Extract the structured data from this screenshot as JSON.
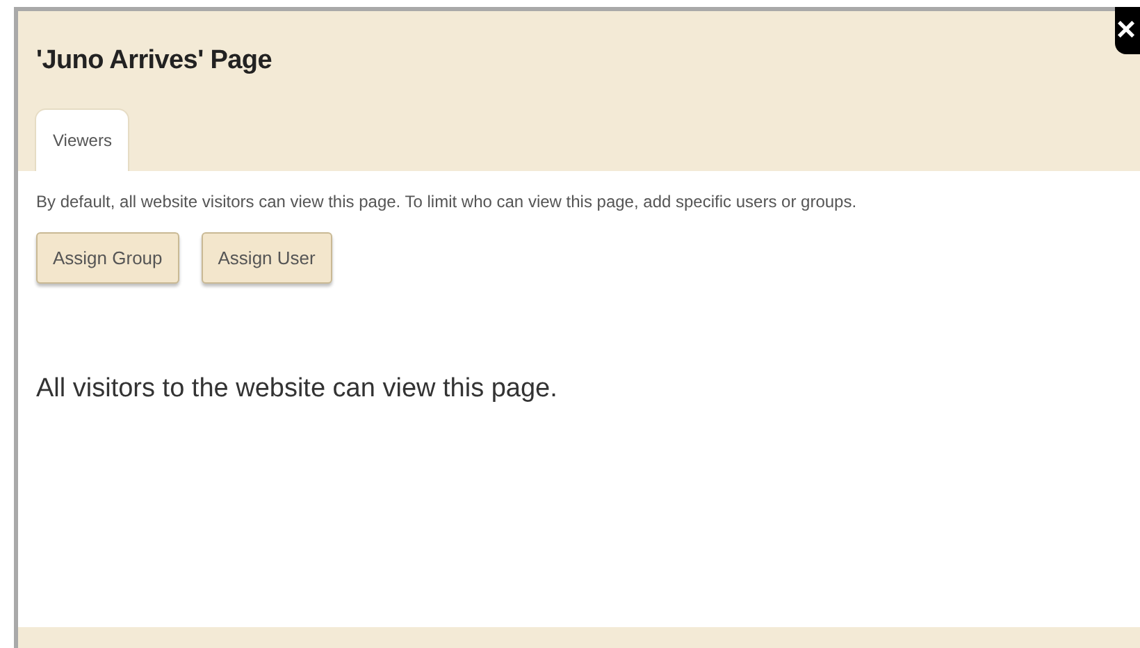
{
  "dialog": {
    "title": "'Juno Arrives' Page",
    "close": "×"
  },
  "tabs": [
    {
      "label": "Viewers",
      "selected": true
    }
  ],
  "description": "By default, all website visitors can view this page. To limit who can view this page, add specific users or groups.",
  "buttons": [
    "Assign Group",
    "Assign User"
  ],
  "message": "All visitors to the website can view this page."
}
